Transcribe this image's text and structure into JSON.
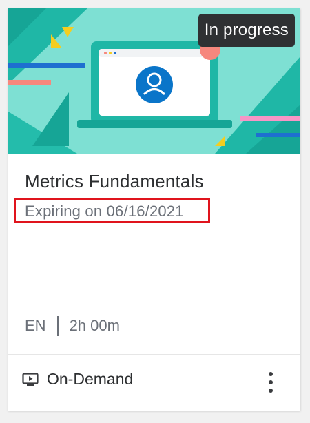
{
  "card": {
    "status": "In progress",
    "title": "Metrics Fundamentals",
    "expiry": "Expiring on 06/16/2021",
    "language": "EN",
    "duration": "2h 00m",
    "delivery_type": "On-Demand",
    "thumbnail_icon": "user-circle-icon",
    "type_icon": "tv-icon",
    "more_icon": "more-vertical-icon"
  },
  "colors": {
    "banner_bg": "#7ee0d3",
    "accent_blue": "#0a75c9",
    "badge_bg": "#2f3133",
    "highlight_border": "#e0141d"
  }
}
